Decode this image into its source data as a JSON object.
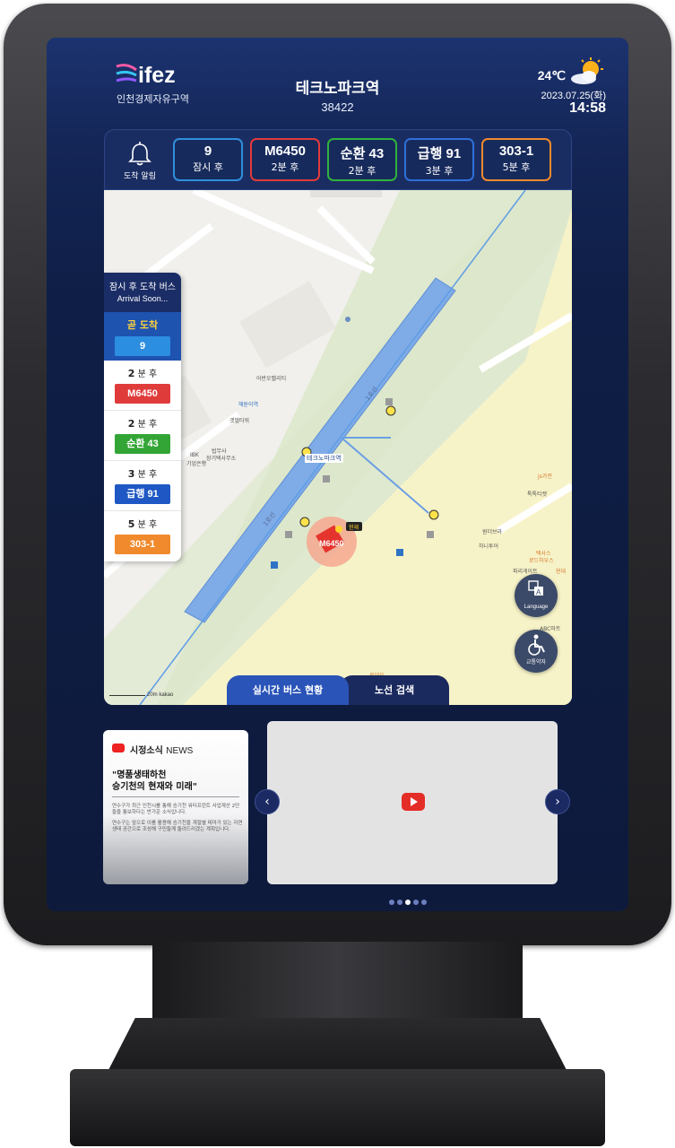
{
  "header": {
    "logo_text": "ifez",
    "logo_subtitle": "인천경제자유구역",
    "station_name": "테크노파크역",
    "station_id": "38422",
    "temperature": "24℃",
    "date": "2023.07.25(화)",
    "time": "14:58",
    "weather_icon": "partly-cloudy-icon"
  },
  "arrival_strip": {
    "alarm_label": "도착 알림",
    "routes": [
      {
        "number": "9",
        "eta": "잠시 후",
        "color": "#2f8fdd"
      },
      {
        "number": "M6450",
        "eta": "2분 후",
        "color": "#e03b3b"
      },
      {
        "number": "순환 43",
        "eta": "2분 후",
        "color": "#2fb33c"
      },
      {
        "number": "급행 91",
        "eta": "3분 후",
        "color": "#2f6fd9"
      },
      {
        "number": "303-1",
        "eta": "5분 후",
        "color": "#f08a2c"
      }
    ]
  },
  "arrival_panel": {
    "title": "잠시 후 도착 버스",
    "subtitle": "Arrival Soon...",
    "soon_label": "곧 도착",
    "soon_route": "9",
    "items": [
      {
        "minutes": "2",
        "unit": "분 후",
        "route": "M6450",
        "color": "#e03b3b"
      },
      {
        "minutes": "2",
        "unit": "분 후",
        "route": "순환 43",
        "color": "#33a536"
      },
      {
        "minutes": "3",
        "unit": "분 후",
        "route": "급행 91",
        "color": "#1f58c4"
      },
      {
        "minutes": "5",
        "unit": "분 후",
        "route": "303-1",
        "color": "#f08a2c"
      }
    ]
  },
  "map": {
    "rail_label_1": "1호선",
    "rail_label_2": "1호선",
    "station_label": "테크노파크역",
    "bus_marker": "M6450",
    "current_tag": "현재",
    "poi": [
      "어반오벨리티",
      "해돋이역",
      "갯벌타워",
      "법무사",
      "IBK",
      "기업은행",
      "장기택사무소",
      "js가전",
      "톡톡티켓",
      "원더브라",
      "하니투어",
      "텍사스",
      "로드하우스",
      "파리게이트",
      "현대",
      "ABC마트",
      "로데오"
    ],
    "scale": "20m",
    "brand": "kakao",
    "language_label": "Language",
    "accessibility_label": "교통약자"
  },
  "tabs": {
    "active": "실시간 버스 현황",
    "idle": "노선 검색"
  },
  "news": {
    "heading": "시정소식",
    "heading_suffix": "NEWS",
    "title_line1": "\"명품생태하천",
    "title_line2": "승기천의 현재와 미래\"",
    "body_1": "연수구가 최근 인천시를 통해 승기천 워터프런트 사업계산 2단 들을 통보하다는 반가운 소식입니다.",
    "body_2": "연수구는 앞으로 이를 활용해 승기천을 계절별 테마가 있는 자연 생태 공간으로 조성해 구민들께 돌려드리겠는 계획입니다."
  },
  "carousel": {
    "prev": "‹",
    "next": "›",
    "total_dots": 5,
    "active_dot": 3
  }
}
